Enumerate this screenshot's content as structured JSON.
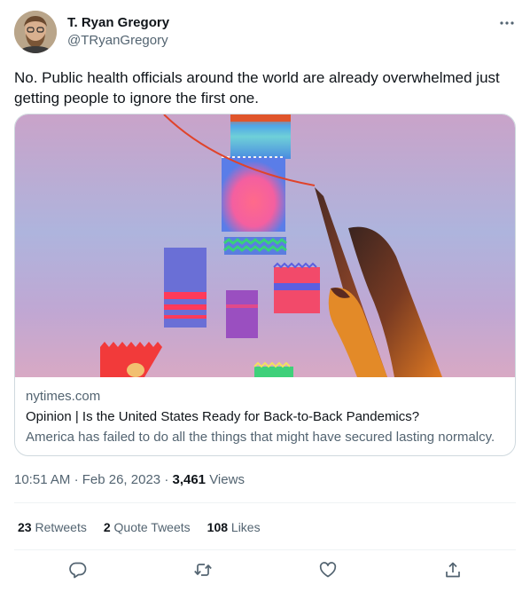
{
  "author": {
    "display_name": "T. Ryan Gregory",
    "handle": "@TRyanGregory"
  },
  "tweet": {
    "text": "No. Public health officials around the world are already overwhelmed just getting people to ignore the first one."
  },
  "card": {
    "domain": "nytimes.com",
    "title": "Opinion | Is the United States Ready for Back-to-Back Pandemics?",
    "description": "America has failed to do all the things that might have secured lasting normalcy."
  },
  "meta": {
    "time": "10:51 AM",
    "separator": "·",
    "date": "Feb 26, 2023",
    "views_count": "3,461",
    "views_label": "Views"
  },
  "stats": {
    "retweets_count": "23",
    "retweets_label": "Retweets",
    "quotes_count": "2",
    "quotes_label": "Quote Tweets",
    "likes_count": "108",
    "likes_label": "Likes"
  },
  "icons": {
    "more": "more-icon",
    "reply": "reply-icon",
    "retweet": "retweet-icon",
    "like": "like-icon",
    "share": "share-icon"
  },
  "colors": {
    "text_primary": "#0f1419",
    "text_secondary": "#536471",
    "border": "#cfd9de"
  }
}
